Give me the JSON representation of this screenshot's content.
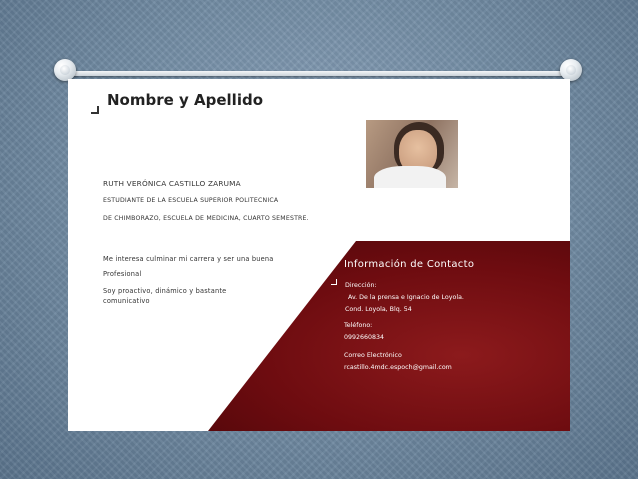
{
  "slide": {
    "title": "Nombre y Apellido",
    "name": "RUTH VERÓNICA CASTILLO ZARUMA",
    "study_line1": "ESTUDIANTE DE LA ESCUELA SUPERIOR POLITECNICA",
    "study_line2": "DE CHIMBORAZO, ESCUELA DE MEDICINA, CUARTO SEMESTRE.",
    "interest": "Me interesa culminar mi carrera y ser una buena",
    "profesional": "Profesional",
    "traits_line1": "Soy proactivo, dinámico y bastante",
    "traits_line2": "comunicativo"
  },
  "contact": {
    "heading": "Información de Contacto",
    "direccion_label": "Dirección:",
    "address_line1": "Av. De la prensa e Ignacio de Loyola.",
    "address_line2": "Cond. Loyola, Blq. 54",
    "telefono_label": "Teléfono:",
    "telefono": "0992660834",
    "correo_label": "Correo Electrónico",
    "correo": "rcastillo.4mdc.espoch@gmail.com"
  },
  "colors": {
    "panel": "#6e0c10",
    "background": "#6d879f"
  }
}
